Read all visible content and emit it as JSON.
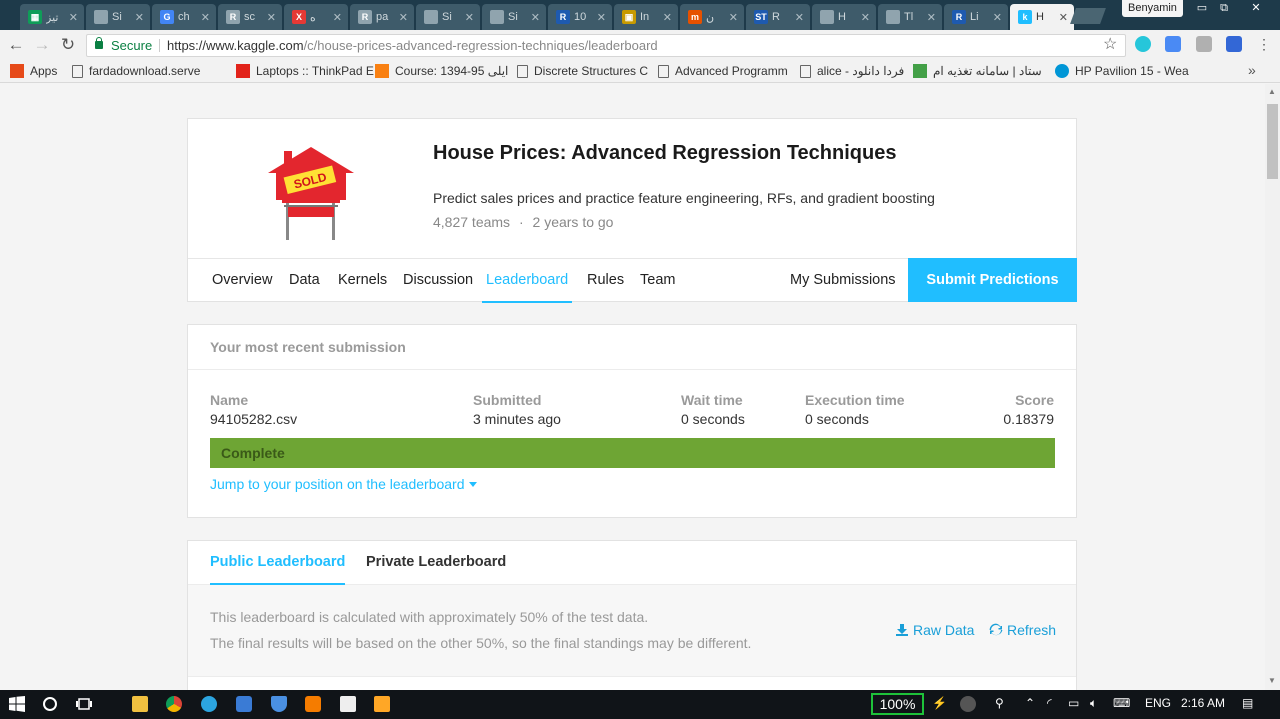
{
  "browser": {
    "tabs": [
      {
        "title": "تیز",
        "icon_color": "#0f9d58",
        "icon_glyph": "▦"
      },
      {
        "title": "Si",
        "icon_color": "#90a4ae",
        "icon_glyph": ""
      },
      {
        "title": "ch",
        "icon_color": "#4285f4",
        "icon_glyph": "G"
      },
      {
        "title": "sc",
        "icon_color": "#90a4ae",
        "icon_glyph": "R"
      },
      {
        "title": "ه",
        "icon_color": "#e53935",
        "icon_glyph": "X"
      },
      {
        "title": "pa",
        "icon_color": "#90a4ae",
        "icon_glyph": "R"
      },
      {
        "title": "Si",
        "icon_color": "#90a4ae",
        "icon_glyph": ""
      },
      {
        "title": "Si",
        "icon_color": "#90a4ae",
        "icon_glyph": ""
      },
      {
        "title": "10",
        "icon_color": "#1e5ab0",
        "icon_glyph": "R"
      },
      {
        "title": "In",
        "icon_color": "#c79a00",
        "icon_glyph": "▣"
      },
      {
        "title": "ن",
        "icon_color": "#e65100",
        "icon_glyph": "m"
      },
      {
        "title": "R",
        "icon_color": "#1e5ab0",
        "icon_glyph": "ST"
      },
      {
        "title": "H",
        "icon_color": "#90a4ae",
        "icon_glyph": ""
      },
      {
        "title": "Tl",
        "icon_color": "#90a4ae",
        "icon_glyph": ""
      },
      {
        "title": "Li",
        "icon_color": "#1e5ab0",
        "icon_glyph": "R"
      },
      {
        "title": "H",
        "icon_color": "#20beff",
        "icon_glyph": "k",
        "active": true
      }
    ],
    "profile_name": "Benyamin",
    "secure_label": "Secure",
    "url_prefix": "https://www.kaggle.com",
    "url_path": "/c/house-prices-advanced-regression-techniques/leaderboard",
    "bookmarks": [
      {
        "label": "Apps",
        "icon": "apps-grid-icon"
      },
      {
        "label": "fardadownload.serve",
        "icon": "page-icon"
      },
      {
        "label": "Laptops :: ThinkPad E",
        "icon": "lenovo-icon"
      },
      {
        "label": "Course: 1394-95 ایلی",
        "icon": "moodle-icon"
      },
      {
        "label": "Discrete Structures C",
        "icon": "page-icon"
      },
      {
        "label": "Advanced Programm",
        "icon": "page-icon"
      },
      {
        "label": "alice - فردا دانلود",
        "icon": "page-icon"
      },
      {
        "label": "ستاد | سامانه تغذیه ام",
        "icon": "setad-icon"
      },
      {
        "label": "HP Pavilion 15 - Wea",
        "icon": "hp-icon"
      }
    ],
    "bookmarks_overflow": "»"
  },
  "competition": {
    "title": "House Prices: Advanced Regression Techniques",
    "subtitle": "Predict sales prices and practice feature engineering, RFs, and gradient boosting",
    "teams": "4,827 teams",
    "separator": "·",
    "time_left": "2 years to go",
    "sign_text": "SOLD",
    "nav": {
      "overview": "Overview",
      "data": "Data",
      "kernels": "Kernels",
      "discussion": "Discussion",
      "leaderboard": "Leaderboard",
      "rules": "Rules",
      "team": "Team",
      "my_submissions": "My Submissions",
      "submit": "Submit Predictions"
    }
  },
  "recent_submission": {
    "heading": "Your most recent submission",
    "columns": {
      "name": {
        "label": "Name",
        "value": "94105282.csv"
      },
      "submitted": {
        "label": "Submitted",
        "value": "3 minutes ago"
      },
      "wait": {
        "label": "Wait time",
        "value": "0 seconds"
      },
      "execution": {
        "label": "Execution time",
        "value": "0 seconds"
      },
      "score": {
        "label": "Score",
        "value": "0.18379"
      }
    },
    "status": "Complete",
    "status_color": "#6ea534",
    "jump_link": "Jump to your position on the leaderboard"
  },
  "leaderboard": {
    "tabs": {
      "public": "Public Leaderboard",
      "private": "Private Leaderboard"
    },
    "note_line1": "This leaderboard is calculated with approximately 50% of the test data.",
    "note_line2": "The final results will be based on the other 50%, so the final standings may be different.",
    "raw_data": "Raw Data",
    "refresh": "Refresh"
  },
  "taskbar": {
    "battery": "100%",
    "language": "ENG",
    "time": "2:16 AM"
  },
  "colors": {
    "accent": "#20beff",
    "complete_green": "#6ea534"
  }
}
